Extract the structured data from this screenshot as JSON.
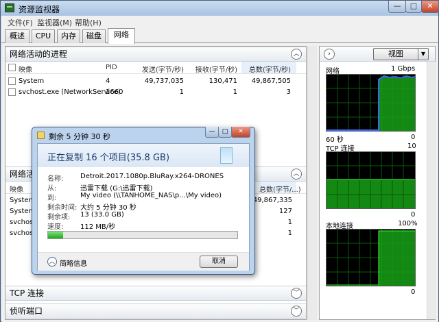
{
  "window": {
    "title": "资源监视器",
    "min": "—",
    "max": "□",
    "close": "✕"
  },
  "menu": [
    "文件(F)",
    "监视器(M)",
    "帮助(H)"
  ],
  "tabs": [
    "概述",
    "CPU",
    "内存",
    "磁盘",
    "网络"
  ],
  "net_processes": {
    "title": "网络活动的进程",
    "columns": [
      "映像",
      "PID",
      "发送(字节/秒)",
      "接收(字节/秒)",
      "总数(字节/秒)"
    ],
    "rows": [
      [
        "System",
        "4",
        "49,737,035",
        "130,471",
        "49,867,505"
      ],
      [
        "svchost.exe (NetworkService)",
        "1660",
        "1",
        "1",
        "3"
      ]
    ]
  },
  "net_activity": {
    "title": "网络活",
    "columns": [
      "映像",
      "总数(字节/...)"
    ],
    "rows": [
      [
        "System",
        "49,867,335"
      ],
      [
        "System",
        "127"
      ],
      [
        "svchost.",
        "1"
      ],
      [
        "svchost.",
        "1"
      ]
    ]
  },
  "tcp_section": "TCP 连接",
  "ports_section": "侦听端口",
  "right_panel": {
    "view_label": "视图",
    "graphs": [
      {
        "name": "网络",
        "max": "1 Gbps",
        "left_bottom": "60 秒",
        "right_bottom": "0"
      },
      {
        "name": "TCP 连接",
        "max": "10",
        "left_bottom": "",
        "right_bottom": "0"
      },
      {
        "name": "本地连接",
        "max": "100%",
        "left_bottom": "",
        "right_bottom": "0"
      }
    ]
  },
  "dialog": {
    "title": "剩余 5 分钟 30 秒",
    "heading": "正在复制 16 个项目(35.8 GB)",
    "fields": [
      {
        "label": "名称:",
        "value": "Detroit.2017.1080p.BluRay.x264-DRONES"
      },
      {
        "label": "从:",
        "value": "迅雷下载 (G:\\迅雷下载)"
      },
      {
        "label": "到:",
        "value": "My video (\\\\TANHOME_NAS\\p...\\My video)"
      },
      {
        "label": "剩余时间:",
        "value": "大约 5 分钟 30 秒"
      },
      {
        "label": "剩余项:",
        "value": "13 (33.0 GB)"
      },
      {
        "label": "速度:",
        "value": "112 MB/秒"
      }
    ],
    "progress": 0.08,
    "more_info": "简略信息",
    "cancel": "取消"
  }
}
